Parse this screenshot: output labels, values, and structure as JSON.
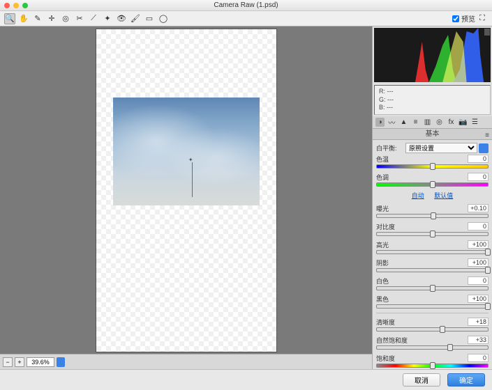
{
  "window": {
    "title": "Camera Raw (1.psd)"
  },
  "toolbar": {
    "preview_label": "预览",
    "fullscreen_icon": "⛶"
  },
  "zoom": {
    "value": "39.6%"
  },
  "rgb": {
    "r_label": "R:",
    "g_label": "G:",
    "b_label": "B:",
    "r": "---",
    "g": "---",
    "b": "---"
  },
  "panel": {
    "title": "基本",
    "wb_label": "白平衡:",
    "wb_value": "原照设置",
    "auto": "自动",
    "default": "默认值",
    "sliders": [
      {
        "name": "色温",
        "value": "0",
        "pos": 50,
        "track": "rainbow"
      },
      {
        "name": "色调",
        "value": "0",
        "pos": 50,
        "track": "tint"
      },
      {
        "name": "曝光",
        "value": "+0.10",
        "pos": 51,
        "track": ""
      },
      {
        "name": "对比度",
        "value": "0",
        "pos": 50,
        "track": ""
      },
      {
        "name": "高光",
        "value": "+100",
        "pos": 100,
        "track": ""
      },
      {
        "name": "阴影",
        "value": "+100",
        "pos": 100,
        "track": ""
      },
      {
        "name": "白色",
        "value": "0",
        "pos": 50,
        "track": ""
      },
      {
        "name": "黑色",
        "value": "+100",
        "pos": 100,
        "track": ""
      },
      {
        "name": "清晰度",
        "value": "+18",
        "pos": 59,
        "track": ""
      },
      {
        "name": "自然饱和度",
        "value": "+33",
        "pos": 66,
        "track": ""
      },
      {
        "name": "饱和度",
        "value": "0",
        "pos": 50,
        "track": "sat"
      }
    ]
  },
  "footer": {
    "cancel": "取消",
    "ok": "确定"
  }
}
